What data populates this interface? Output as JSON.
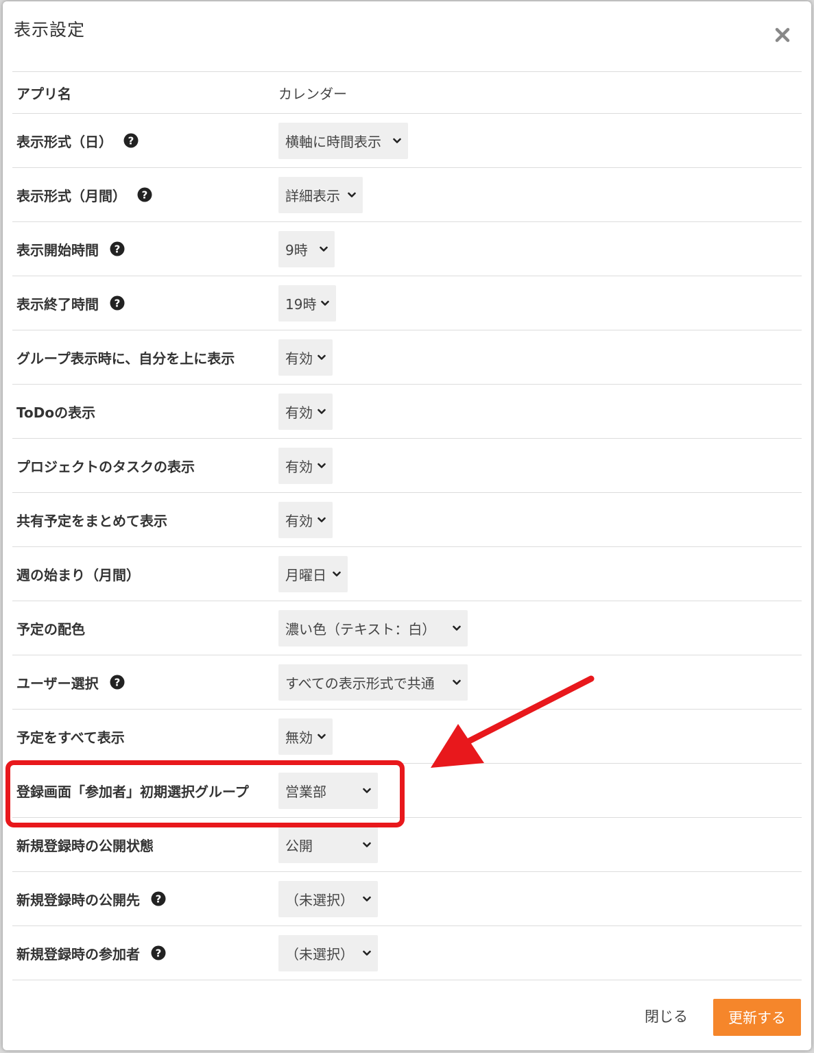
{
  "dialog": {
    "title": "表示設定",
    "close_icon": "close-icon",
    "accent_color": "#f5862b",
    "highlight_color": "#e8181c"
  },
  "rows": [
    {
      "label": "アプリ名",
      "value": "カレンダー",
      "help": false,
      "select": false
    },
    {
      "label": "表示形式（日）",
      "value": "横軸に時間表示",
      "help": true,
      "select": true
    },
    {
      "label": "表示形式（月間）",
      "value": "詳細表示",
      "help": true,
      "select": true
    },
    {
      "label": "表示開始時間",
      "value": "9時",
      "help": true,
      "select": true
    },
    {
      "label": "表示終了時間",
      "value": "19時",
      "help": true,
      "select": true
    },
    {
      "label": "グループ表示時に、自分を上に表示",
      "value": "有効",
      "help": false,
      "select": true
    },
    {
      "label": "ToDoの表示",
      "value": "有効",
      "help": false,
      "select": true
    },
    {
      "label": "プロジェクトのタスクの表示",
      "value": "有効",
      "help": false,
      "select": true
    },
    {
      "label": "共有予定をまとめて表示",
      "value": "有効",
      "help": false,
      "select": true
    },
    {
      "label": "週の始まり（月間）",
      "value": "月曜日",
      "help": false,
      "select": true
    },
    {
      "label": "予定の配色",
      "value": "濃い色（テキスト：白）",
      "help": false,
      "select": true
    },
    {
      "label": "ユーザー選択",
      "value": "すべての表示形式で共通",
      "help": true,
      "select": true
    },
    {
      "label": "予定をすべて表示",
      "value": "無効",
      "help": false,
      "select": true
    },
    {
      "label": "登録画面「参加者」初期選択グループ",
      "value": "営業部",
      "help": false,
      "select": true
    },
    {
      "label": "新規登録時の公開状態",
      "value": "公開",
      "help": false,
      "select": true
    },
    {
      "label": "新規登録時の公開先",
      "value": "（未選択）",
      "help": true,
      "select": true
    },
    {
      "label": "新規登録時の参加者",
      "value": "（未選択）",
      "help": true,
      "select": true
    }
  ],
  "footer": {
    "close_label": "閉じる",
    "update_label": "更新する"
  }
}
